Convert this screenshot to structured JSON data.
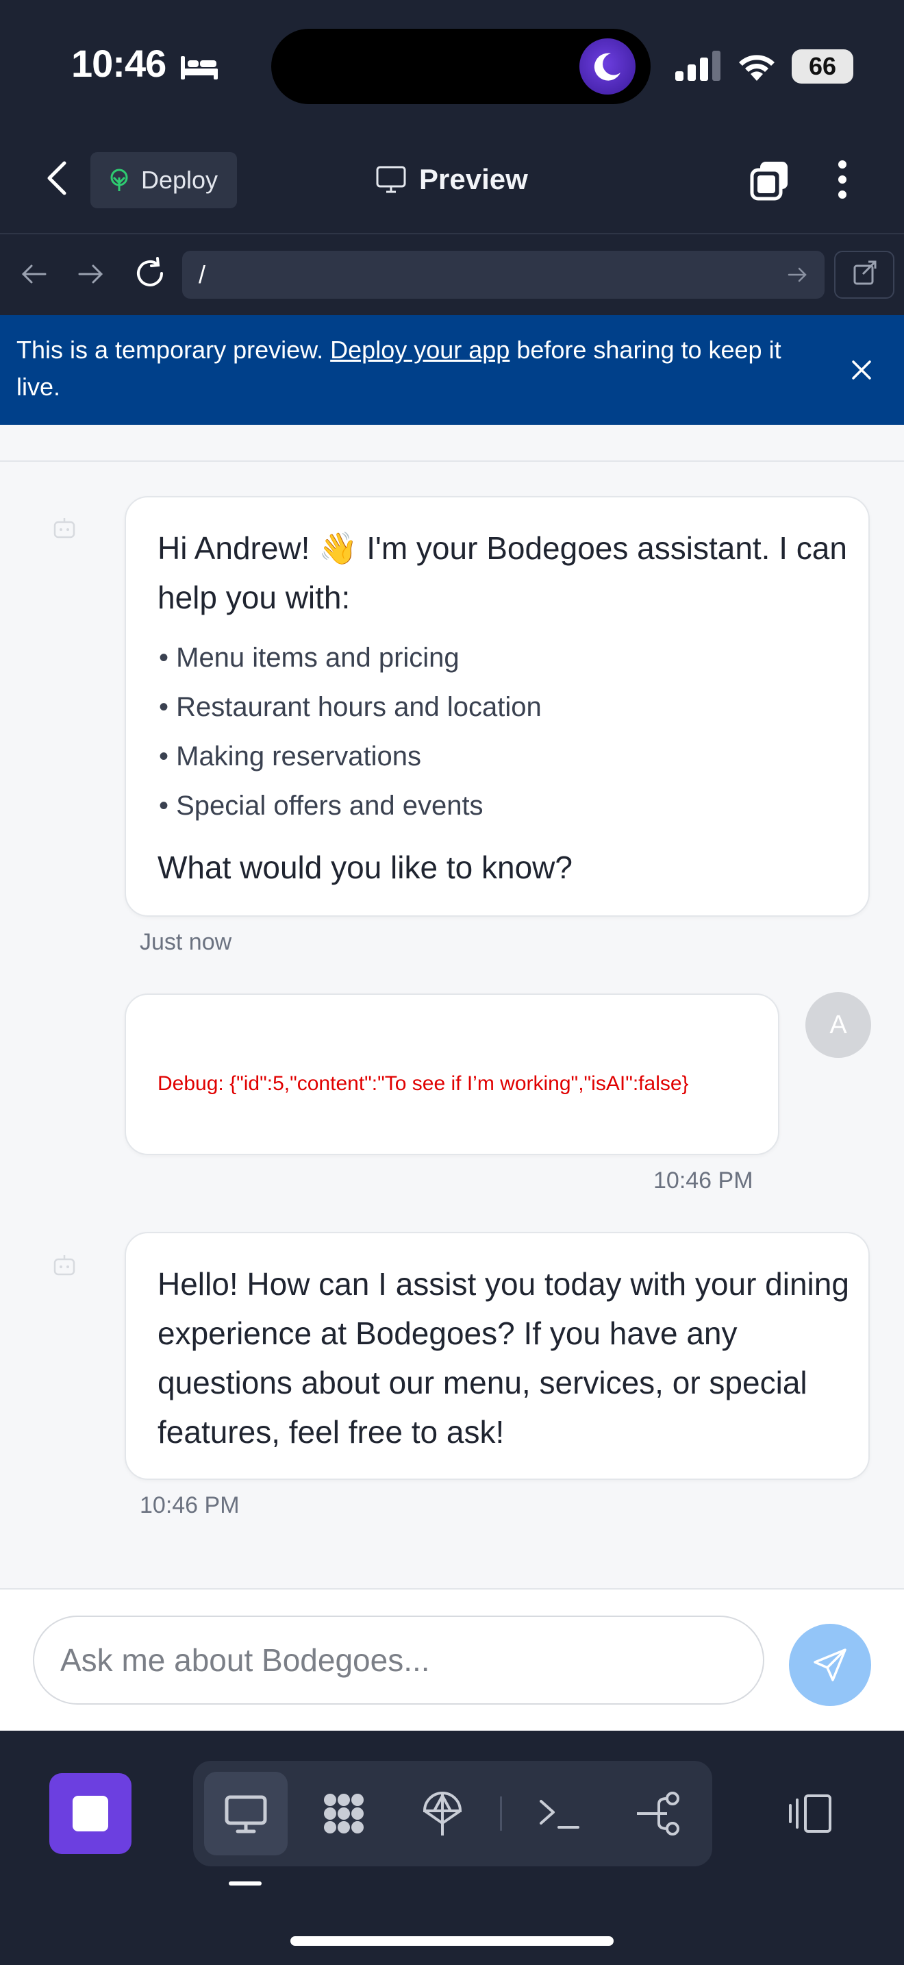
{
  "status_bar": {
    "time": "10:46",
    "battery": "66"
  },
  "header": {
    "deploy_label": "Deploy",
    "title": "Preview"
  },
  "browser": {
    "url": "/"
  },
  "banner": {
    "text_before": "This is a temporary preview. ",
    "link": "Deploy your app",
    "text_after": " before sharing to keep it live."
  },
  "messages": {
    "bot_greeting": {
      "intro": "Hi Andrew! 👋 I'm your Bodegoes assistant. I can help you with:",
      "items": [
        "• Menu items and pricing",
        "• Restaurant hours and location",
        "• Making reservations",
        "• Special offers and events"
      ],
      "outro": "What would you like to know?",
      "time": "Just now"
    },
    "user_msg": {
      "debug": "Debug: {\"id\":5,\"content\":\"To see if I’m working\",\"isAI\":false}",
      "time": "10:46 PM",
      "avatar": "A"
    },
    "bot_reply": {
      "text": "Hello! How can I assist you today with your dining experience at Bodegoes? If you have any questions about our menu, services, or special features, feel free to ask!",
      "time": "10:46 PM"
    }
  },
  "input": {
    "placeholder": "Ask me about Bodegoes..."
  },
  "toolbar": {
    "tools": [
      "monitor-icon",
      "grid-icon",
      "deploy-icon",
      "terminal-icon",
      "git-icon"
    ],
    "colors": {
      "stop": "#6c3fe0",
      "send": "#93c5f8",
      "banner": "#00408a"
    }
  }
}
